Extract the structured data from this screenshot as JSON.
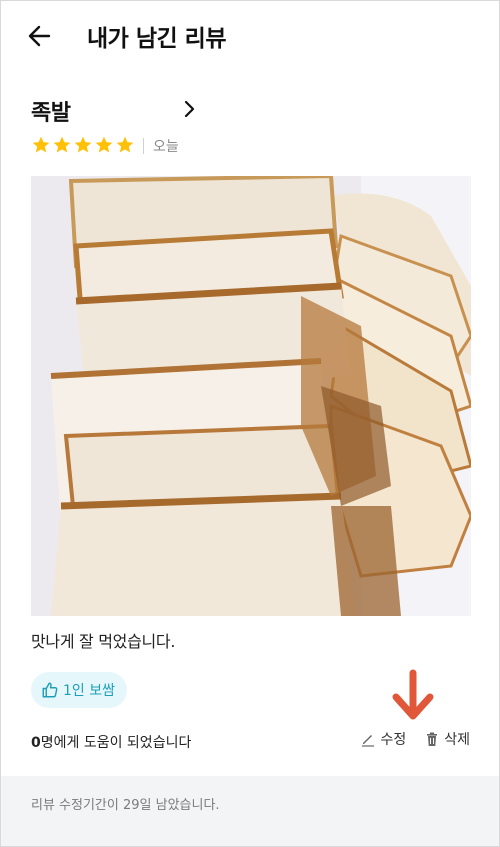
{
  "header": {
    "title": "내가 남긴 리뷰",
    "back_icon": "arrow-left-icon"
  },
  "review": {
    "store_name": "족발",
    "store_chevron_icon": "chevron-right-icon",
    "rating": 5,
    "rating_max": 5,
    "star_color": "#FFC107",
    "date": "오늘",
    "photo_description_icon": "food-photo",
    "text": "맛나게 잘 먹었습니다.",
    "recommend_label": "1인 보쌈",
    "recommend_icon": "thumbs-up-icon",
    "helpful_count": "0",
    "helpful_suffix": "명에게 도움이 되었습니다",
    "edit_label": "수정",
    "delete_label": "삭제",
    "accent_color": "#1E9FB9",
    "annotation_arrow_color": "#E0573A"
  },
  "footer": {
    "notice": "리뷰 수정기간이 29일 남았습니다."
  }
}
